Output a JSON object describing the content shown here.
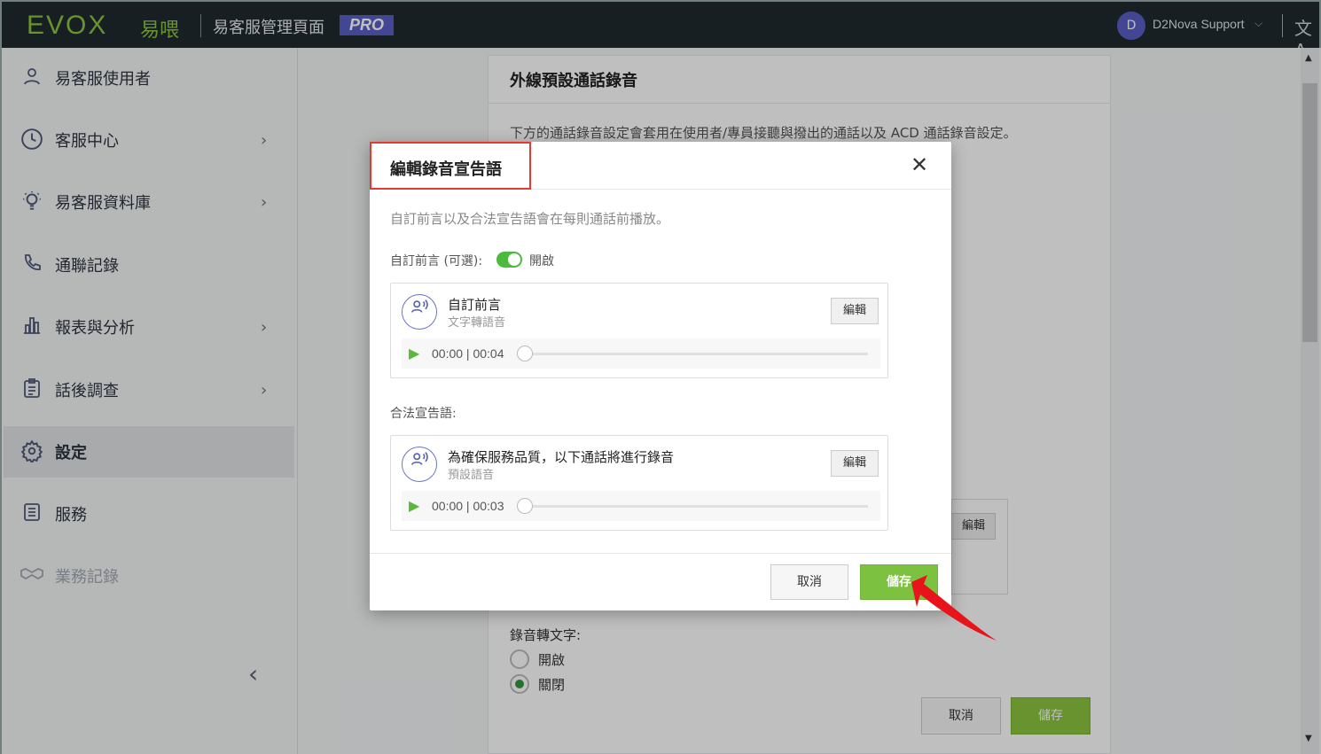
{
  "topbar": {
    "logo": "EVOX",
    "logo_cn": "易喂",
    "app_title": "易客服管理頁面",
    "badge": "PRO",
    "user_initial": "D",
    "user_name": "D2Nova Support",
    "caret": "⌵",
    "lang_icon": "文A"
  },
  "sidebar": {
    "items": [
      {
        "label": "易客服使用者",
        "icon": "user-icon"
      },
      {
        "label": "客服中心",
        "icon": "headset-icon"
      },
      {
        "label": "易客服資料庫",
        "icon": "lightbulb-icon"
      },
      {
        "label": "通聯記錄",
        "icon": "phone-icon"
      },
      {
        "label": "報表與分析",
        "icon": "bar-chart-icon"
      },
      {
        "label": "話後調查",
        "icon": "clipboard-icon"
      },
      {
        "label": "設定",
        "icon": "gear-icon"
      },
      {
        "label": "服務",
        "icon": "list-icon"
      },
      {
        "label": "業務記錄",
        "icon": "handshake-icon"
      }
    ],
    "chevron": "›",
    "collapse": "‹"
  },
  "main": {
    "card_title": "外線預設通話錄音",
    "card_desc": "下方的通話錄音設定會套用在使用者/專員接聽與撥出的通話以及 ACD 通話錄音設定。",
    "edit_label": "編輯",
    "transcription_label": "錄音轉文字:",
    "radio_on": "開啟",
    "radio_off": "關閉",
    "cancel": "取消",
    "save": "儲存"
  },
  "modal": {
    "title": "編輯錄音宣告語",
    "close": "✕",
    "description": "自訂前言以及合法宣告語會在每則通話前播放。",
    "preamble_label": "自訂前言 (可選):",
    "toggle_state": "開啟",
    "preamble_card": {
      "title": "自訂前言",
      "subtitle": "文字轉語音",
      "edit": "編輯",
      "time": "00:00 | 00:04"
    },
    "legal_label": "合法宣告語:",
    "legal_card": {
      "title": "為確保服務品質，以下通話將進行錄音",
      "subtitle": "預設語音",
      "edit": "編輯",
      "time": "00:00 | 00:03"
    },
    "cancel": "取消",
    "save": "儲存"
  },
  "colors": {
    "accent_green": "#8cc43f",
    "highlight_red": "#e53935",
    "badge_purple": "#5a5fc4"
  }
}
